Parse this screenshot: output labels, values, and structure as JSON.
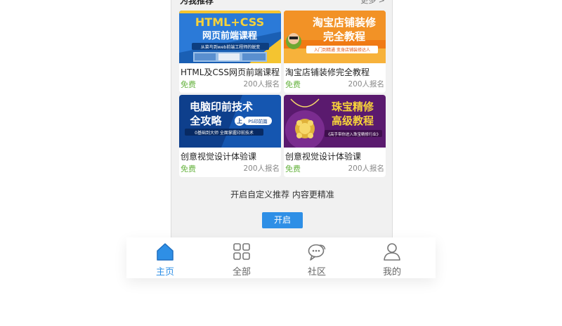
{
  "section": {
    "title": "为我推荐",
    "more": "更多 >"
  },
  "courses": [
    {
      "banner_line1": "HTML+CSS",
      "banner_line2": "网页前端课程",
      "banner_sub": "从菜鸟到web前端工程师的蜕变",
      "title": "HTML及CSS网页前端课程",
      "price": "免费",
      "count": "200人报名"
    },
    {
      "banner_line1": "淘宝店铺装修",
      "banner_line2": "完全教程",
      "banner_sub": "入门到精通 变身店铺装修达人",
      "title": "淘宝店铺装修完全教程",
      "price": "免费",
      "count": "200人报名"
    },
    {
      "banner_line1": "电脑印前技术",
      "banner_line2": "全攻略",
      "banner_badge": "PS印前篇",
      "banner_sub": "0基础到大师 全面掌握印前技术",
      "title": "创意视觉设计体验课",
      "price": "免费",
      "count": "200人报名"
    },
    {
      "banner_line1": "珠宝精修",
      "banner_line2": "高级教程",
      "banner_sub": "《高手带你进入珠宝精修行业》",
      "title": "创意视觉设计体验课",
      "price": "免费",
      "count": "200人报名"
    }
  ],
  "promo": {
    "text": "开启自定义推荐 内容更精准",
    "button": "开启"
  },
  "tabbar": [
    {
      "label": "主页",
      "icon": "home-icon",
      "active": true
    },
    {
      "label": "全部",
      "icon": "grid-icon",
      "active": false
    },
    {
      "label": "社区",
      "icon": "chat-icon",
      "active": false
    },
    {
      "label": "我的",
      "icon": "user-icon",
      "active": false
    }
  ],
  "colors": {
    "accent": "#2e8fe6",
    "price": "#66b33f"
  }
}
